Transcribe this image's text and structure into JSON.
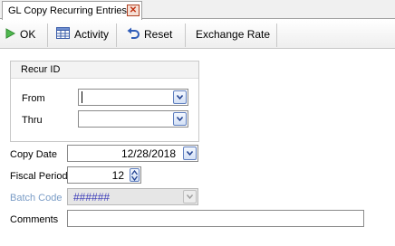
{
  "tab": {
    "title": "GL Copy Recurring Entries",
    "close_glyph": "✕"
  },
  "toolbar": {
    "ok_label": "OK",
    "activity_label": "Activity",
    "reset_label": "Reset",
    "exchange_label": "Exchange Rate"
  },
  "recur_group": {
    "title": "Recur ID",
    "from_label": "From",
    "from_value": "",
    "thru_label": "Thru",
    "thru_value": ""
  },
  "form": {
    "copy_date_label": "Copy Date",
    "copy_date_value": "12/28/2018",
    "fiscal_period_label": "Fiscal Period",
    "fiscal_period_value": "12",
    "batch_code_label": "Batch Code",
    "batch_code_value": "######",
    "comments_label": "Comments",
    "comments_value": ""
  },
  "colors": {
    "accent": "#5f7fbf",
    "disabled_label": "#7a9cc6",
    "ok_green": "#2f9a2f",
    "close_red": "#c03010"
  },
  "icons": [
    "close-icon",
    "play-icon",
    "grid-icon",
    "undo-icon",
    "chevron-down-icon",
    "spin-icon"
  ]
}
